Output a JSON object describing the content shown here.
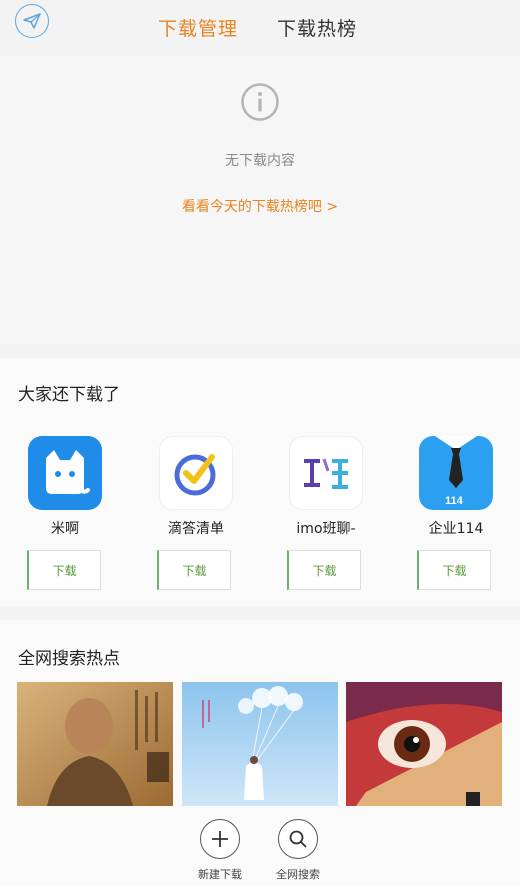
{
  "header": {
    "logo_icon": "paper-plane-icon",
    "tabs": [
      {
        "label": "下载管理",
        "active": true
      },
      {
        "label": "下载热榜",
        "active": false
      }
    ],
    "accent_color": "#e98420"
  },
  "empty_state": {
    "icon": "info-icon",
    "message": "无下载内容",
    "link_text": "看看今天的下载热榜吧 >"
  },
  "recommend": {
    "title": "大家还下载了",
    "apps": [
      {
        "name": "米啊",
        "button": "下载",
        "icon": "cat-face-app-icon"
      },
      {
        "name": "滴答清单",
        "button": "下载",
        "icon": "checkmark-app-icon"
      },
      {
        "name": "imo班聊-",
        "button": "下载",
        "icon": "ban-character-app-icon"
      },
      {
        "name": "企业114",
        "button": "下载",
        "icon": "necktie-114-app-icon"
      }
    ]
  },
  "hot_search": {
    "title": "全网搜索热点",
    "posters": [
      {
        "icon": "poster-monk-image"
      },
      {
        "icon": "poster-balloons-image"
      },
      {
        "icon": "poster-eye-image"
      }
    ]
  },
  "bottom_actions": [
    {
      "label": "新建下载",
      "icon": "plus-icon"
    },
    {
      "label": "全网搜索",
      "icon": "search-icon"
    }
  ]
}
